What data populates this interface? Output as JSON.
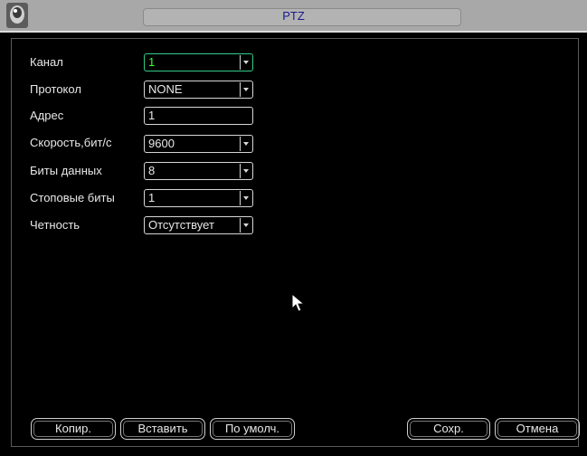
{
  "window": {
    "title": "PTZ"
  },
  "fields": [
    {
      "label": "Канал",
      "value": "1"
    },
    {
      "label": "Протокол",
      "value": "NONE"
    },
    {
      "label": "Адрес",
      "value": "1"
    },
    {
      "label": "Скорость,бит/с",
      "value": "9600"
    },
    {
      "label": "Биты данных",
      "value": "8"
    },
    {
      "label": "Стоповые биты",
      "value": "1"
    },
    {
      "label": "Четность",
      "value": "Отсутствует"
    }
  ],
  "buttons": {
    "copy": "Копир.",
    "paste": "Вставить",
    "default": "По умолч.",
    "save": "Сохр.",
    "cancel": "Отмена"
  },
  "colors": {
    "background": "#000000",
    "title_bar": "#a8a8a8",
    "title_text": "#1a1a8c",
    "active_value": "#33ff33",
    "text": "#e8e8e8"
  }
}
